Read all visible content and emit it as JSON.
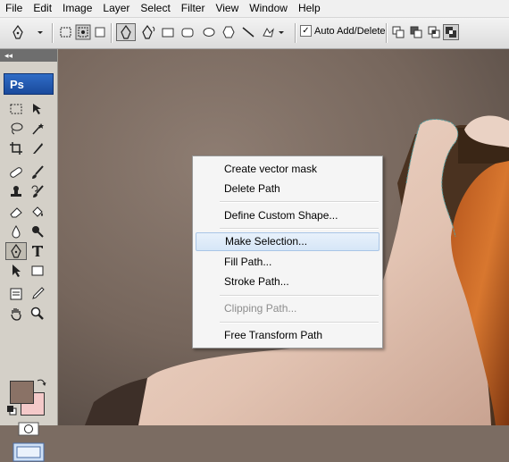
{
  "menubar": [
    "File",
    "Edit",
    "Image",
    "Layer",
    "Select",
    "Filter",
    "View",
    "Window",
    "Help"
  ],
  "options": {
    "auto_add_delete_label": "Auto Add/Delete",
    "auto_add_delete_checked": true,
    "checkmark": "✓"
  },
  "toolbox": {
    "collapse_glyph": "◂◂",
    "logo": "Ps"
  },
  "context_menu": {
    "items": [
      {
        "label": "Create vector mask"
      },
      {
        "label": "Delete Path"
      },
      {
        "label": "Define Custom Shape..."
      },
      {
        "label": "Make Selection..."
      },
      {
        "label": "Fill Path..."
      },
      {
        "label": "Stroke Path..."
      },
      {
        "label": "Clipping Path..."
      },
      {
        "label": "Free Transform Path"
      }
    ]
  },
  "colors": {
    "foreground": "#8a7266",
    "background": "#f4c9c9",
    "accent": "#2f6cc6"
  }
}
